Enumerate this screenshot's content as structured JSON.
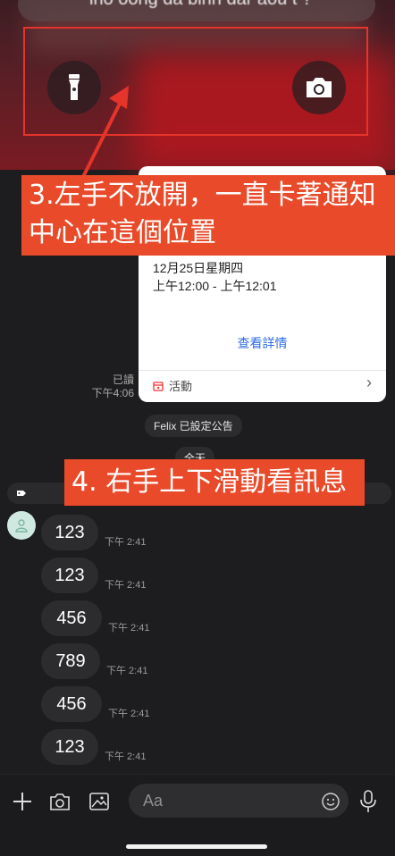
{
  "lock_screen": {
    "notification_text": "lho oong da binn dar aou t ?",
    "flashlight_icon": "flashlight-icon",
    "camera_icon": "camera-icon"
  },
  "annotations": {
    "step3": "3.左手不放開，一直卡著通知中心在這個位置",
    "step4": "4. 右手上下滑動看訊息"
  },
  "event_card": {
    "date": "12月25日星期四",
    "time": "上午12:00 - 上午12:01",
    "details_link": "查看詳情",
    "footer_label": "活動"
  },
  "read_receipt": {
    "status": "已讀",
    "time": "下午4:06"
  },
  "system_messages": {
    "announcement": "Felix 已設定公告",
    "all_day": "全天"
  },
  "messages": [
    {
      "text": "123",
      "time": "下午 2:41"
    },
    {
      "text": "123",
      "time": "下午 2:41"
    },
    {
      "text": "456",
      "time": "下午 2:41"
    },
    {
      "text": "789",
      "time": "下午 2:41"
    },
    {
      "text": "456",
      "time": "下午 2:41"
    },
    {
      "text": "123",
      "time": "下午 2:41"
    }
  ],
  "composer": {
    "placeholder": "Aa"
  },
  "colors": {
    "annotation_bg": "#e84a2a",
    "highlight_border": "#e5342a",
    "link": "#2e6de6",
    "chat_bg": "#1d1d1f",
    "bubble": "#2c2c2e"
  }
}
